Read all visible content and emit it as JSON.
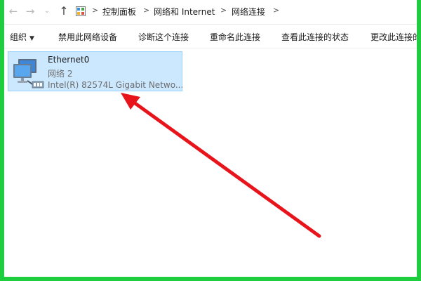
{
  "breadcrumb": {
    "items": [
      "控制面板",
      "网络和 Internet",
      "网络连接"
    ]
  },
  "toolbar": {
    "organize_label": "组织",
    "disable_label": "禁用此网络设备",
    "diagnose_label": "诊断这个连接",
    "rename_label": "重命名此连接",
    "status_label": "查看此连接的状态",
    "change_label": "更改此连接的"
  },
  "connection": {
    "name": "Ethernet0",
    "status": "网络  2",
    "device": "Intel(R) 82574L Gigabit Netwo..."
  },
  "colors": {
    "selection_bg": "#cce8ff",
    "selection_border": "#99d1ff",
    "frame_green": "#1fce3f",
    "annotation_arrow": "#e8141b"
  },
  "icons": {
    "back": "arrow-left-icon",
    "forward": "arrow-right-icon",
    "recent": "chevron-down-icon",
    "up": "arrow-up-icon",
    "location": "control-panel-icon",
    "connection": "network-adapter-icon"
  }
}
